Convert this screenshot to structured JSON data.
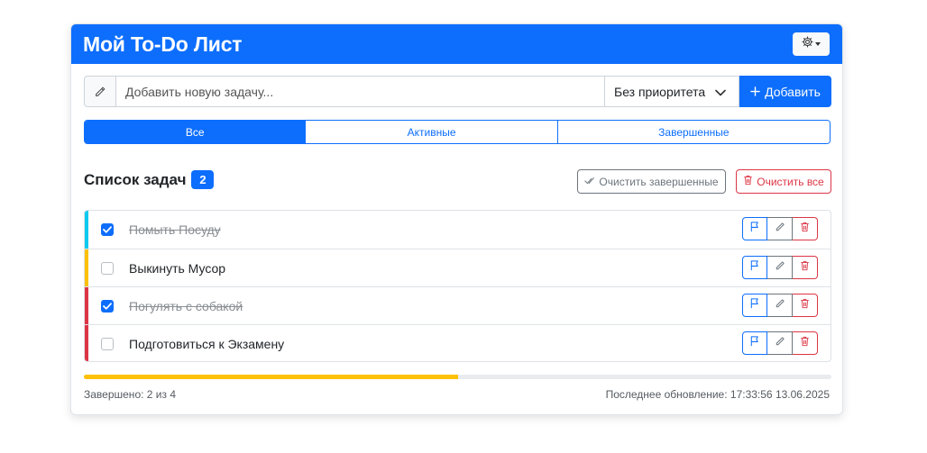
{
  "header": {
    "title": "Мой To-Do Лист",
    "settings_icon": "gear-icon"
  },
  "new_task": {
    "placeholder": "Добавить новую задачу...",
    "value": "",
    "priority_selected": "Без приоритета",
    "add_label": "Добавить"
  },
  "tabs": [
    {
      "label": "Все",
      "active": true
    },
    {
      "label": "Активные",
      "active": false
    },
    {
      "label": "Завершенные",
      "active": false
    }
  ],
  "list": {
    "title": "Список задач",
    "count": "2",
    "clear_done_label": "Очистить завершенные",
    "clear_all_label": "Очистить все"
  },
  "tasks": [
    {
      "text": "Помыть Посуду",
      "done": true,
      "priority_color": "#0dcaf0"
    },
    {
      "text": "Выкинуть Мусор",
      "done": false,
      "priority_color": "#ffc107"
    },
    {
      "text": "Погулять с собакой",
      "done": true,
      "priority_color": "#dc3545"
    },
    {
      "text": "Подготовиться к Экзамену",
      "done": false,
      "priority_color": "#dc3545"
    }
  ],
  "progress": {
    "fraction": 0.5,
    "color": "#ffc107"
  },
  "footer": {
    "completed_text": "Завершено: 2 из 4",
    "updated_text": "Последнее обновление: 17:33:56 13.06.2025"
  },
  "colors": {
    "primary": "#0d6efd",
    "danger": "#dc3545",
    "secondary": "#6c757d",
    "warning": "#ffc107",
    "info": "#0dcaf0"
  }
}
